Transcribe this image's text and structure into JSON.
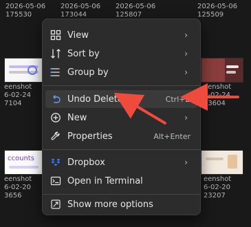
{
  "background": {
    "top_labels": [
      {
        "line1": "2026-05-06",
        "line2": "175530"
      },
      {
        "line1": "2026-05-06",
        "line2": "173044"
      },
      {
        "line1": "2026-05-06",
        "line2": "125807"
      },
      {
        "line1": "2026-05-06",
        "line2": "125509"
      }
    ],
    "left_mid": {
      "line1": "eenshot",
      "line2": "6-02-24",
      "line3": "7104"
    },
    "right_mid": {
      "line1": "eenshot",
      "line2": "6-02-24",
      "line3": "73604"
    },
    "left_bottom": {
      "line1": "eenshot",
      "line2": "6-02-20",
      "line3": "3656"
    },
    "right_bottom": {
      "line1": "eenshot",
      "line2": "6-02-20",
      "line3": "23207"
    },
    "thumb_text": "ccounts"
  },
  "menu": {
    "items": [
      {
        "label": "View",
        "icon": "grid-icon",
        "submenu": true
      },
      {
        "label": "Sort by",
        "icon": "sort-icon",
        "submenu": true
      },
      {
        "label": "Group by",
        "icon": "group-icon",
        "submenu": true
      },
      {
        "label": "Undo Delete",
        "icon": "undo-icon",
        "shortcut": "Ctrl+Z"
      },
      {
        "label": "New",
        "icon": "plus-icon",
        "submenu": true
      },
      {
        "label": "Properties",
        "icon": "wrench-icon",
        "shortcut": "Alt+Enter"
      },
      {
        "label": "Dropbox",
        "icon": "dropbox-icon",
        "submenu": true
      },
      {
        "label": "Open in Terminal",
        "icon": "terminal-icon"
      },
      {
        "label": "Show more options",
        "icon": "more-options-icon"
      }
    ]
  },
  "colors": {
    "menu_bg": "#2c2c2c",
    "text": "#e7e7e7",
    "accent": "#60a5fa",
    "arrow": "#ef4b3d"
  }
}
